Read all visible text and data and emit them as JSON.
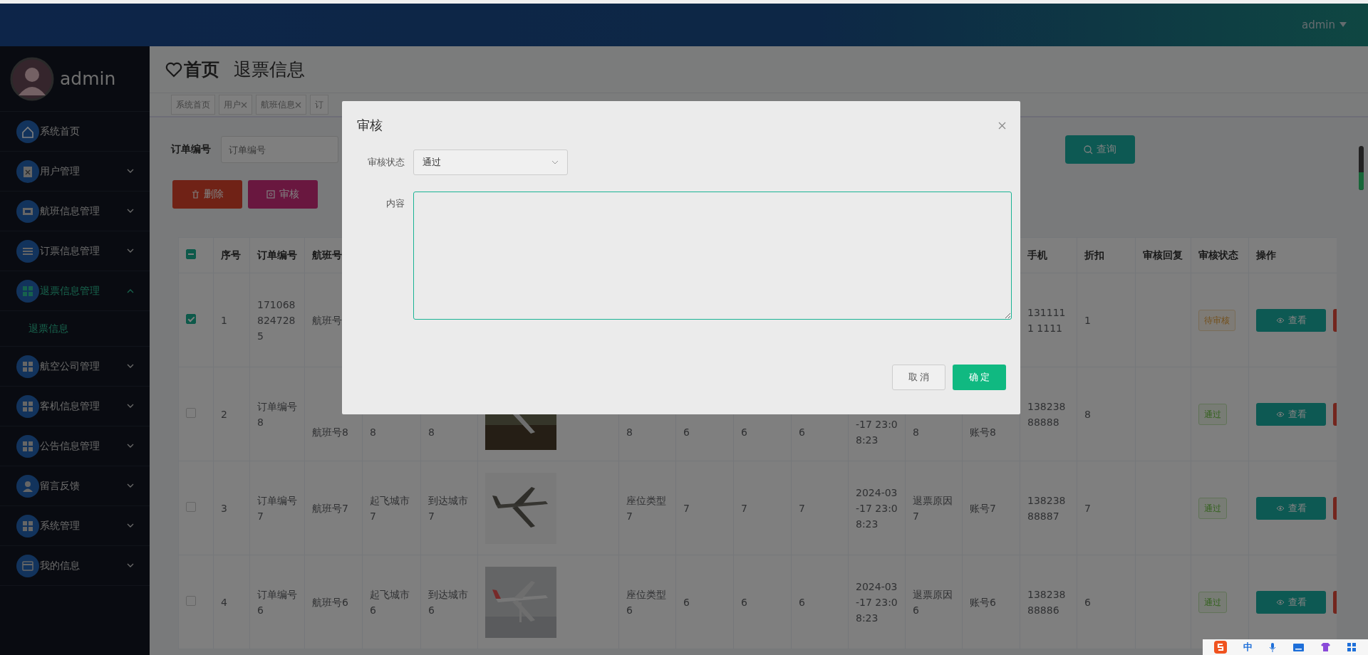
{
  "header": {
    "user": "admin"
  },
  "sidebar": {
    "user": "admin",
    "items": [
      {
        "label": "系统首页",
        "kind": "link",
        "selected": false
      },
      {
        "label": "用户管理",
        "kind": "menu",
        "expanded": false,
        "selected": false
      },
      {
        "label": "航班信息管理",
        "kind": "menu",
        "expanded": false,
        "selected": false
      },
      {
        "label": "订票信息管理",
        "kind": "menu",
        "expanded": false,
        "selected": false
      },
      {
        "label": "退票信息管理",
        "kind": "menu",
        "expanded": true,
        "selected": true,
        "children": [
          {
            "label": "退票信息",
            "selected": true
          }
        ]
      },
      {
        "label": "航空公司管理",
        "kind": "menu",
        "expanded": false,
        "selected": false
      },
      {
        "label": "客机信息管理",
        "kind": "menu",
        "expanded": false,
        "selected": false
      },
      {
        "label": "公告信息管理",
        "kind": "menu",
        "expanded": false,
        "selected": false
      },
      {
        "label": "留言反馈",
        "kind": "menu",
        "expanded": false,
        "selected": false
      },
      {
        "label": "系统管理",
        "kind": "menu",
        "expanded": false,
        "selected": false
      },
      {
        "label": "我的信息",
        "kind": "menu",
        "expanded": false,
        "selected": false
      }
    ]
  },
  "breadcrumb": {
    "home": "首页",
    "current": "退票信息"
  },
  "tabs": [
    {
      "label": "系统首页",
      "closable": false
    },
    {
      "label": "用户",
      "closable": true
    },
    {
      "label": "航班信息",
      "closable": true
    },
    {
      "label": "订",
      "closable": false
    }
  ],
  "search": {
    "label": "订单编号",
    "placeholder": "订单编号",
    "button": "查询"
  },
  "toolbar": {
    "delete": "删除",
    "review": "审核"
  },
  "table": {
    "indeterminate": true,
    "columns": [
      "序号",
      "订单编号",
      "航班号",
      "",
      "",
      "",
      "",
      "",
      "",
      "",
      "",
      "",
      "",
      "手机",
      "折扣",
      "审核回复",
      "审核状态",
      "操作"
    ],
    "rows": [
      {
        "checked": true,
        "cells": [
          "1",
          "1710688247285",
          "航班号",
          "",
          "",
          "",
          "",
          "",
          "",
          "",
          "",
          "",
          "",
          "1311111 1111",
          "1",
          ""
        ],
        "status": {
          "label": "待审核",
          "kind": "pending"
        },
        "action": "查看"
      },
      {
        "checked": false,
        "cells": [
          "2",
          "订单编号8",
          "航班号8",
          "8",
          "8",
          "",
          "8",
          "6",
          "6",
          "6",
          "-17 23:08:23",
          "8",
          "账号8",
          "13823888888",
          "8",
          ""
        ],
        "picture": true,
        "status": {
          "label": "通过",
          "kind": "approved"
        },
        "action": "查看"
      },
      {
        "checked": false,
        "cells": [
          "3",
          "订单编号7",
          "航班号7",
          "起飞城市7",
          "到达城市7",
          "",
          "座位类型7",
          "7",
          "7",
          "7",
          "2024-03-17 23:08:23",
          "退票原因7",
          "账号7",
          "13823888887",
          "7",
          ""
        ],
        "picture": true,
        "status": {
          "label": "通过",
          "kind": "approved"
        },
        "action": "查看"
      },
      {
        "checked": false,
        "cells": [
          "4",
          "订单编号6",
          "航班号6",
          "起飞城市6",
          "到达城市6",
          "",
          "座位类型6",
          "6",
          "6",
          "6",
          "2024-03-17 23:08:23",
          "退票原因6",
          "账号6",
          "13823888886",
          "6",
          ""
        ],
        "picture": true,
        "status": {
          "label": "通过",
          "kind": "approved"
        },
        "action": "查看"
      }
    ]
  },
  "dialog": {
    "title": "审核",
    "status_label": "审核状态",
    "status_value": "通过",
    "content_label": "内容",
    "cancel": "取 消",
    "confirm": "确 定"
  },
  "ime": {
    "label": "中"
  }
}
